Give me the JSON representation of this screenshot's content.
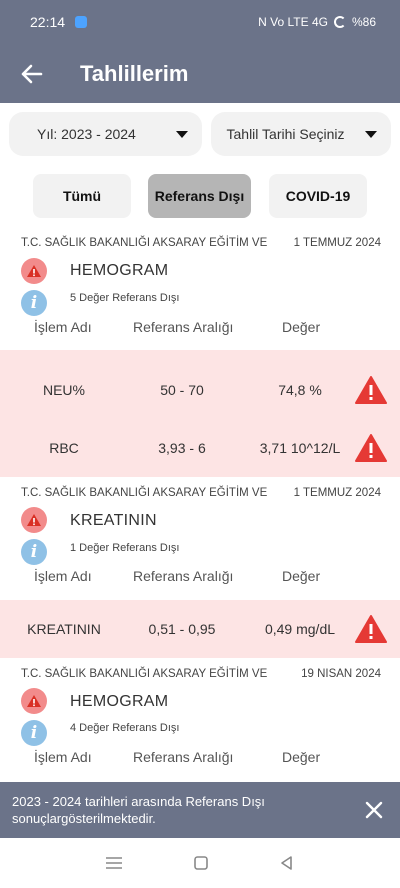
{
  "status_bar": {
    "time": "22:14",
    "indicators": "N  Vo LTE  4G",
    "battery": "%86"
  },
  "app_bar": {
    "title": "Tahlillerim"
  },
  "filters": {
    "year_label": "Yıl: 2023 - 2024",
    "date_label": "Tahlil Tarihi Seçiniz"
  },
  "tabs": [
    {
      "label": "Tümü",
      "active": false
    },
    {
      "label": "Referans Dışı",
      "active": true
    },
    {
      "label": "COVID-19",
      "active": false
    }
  ],
  "columns": {
    "name": "İşlem Adı",
    "range": "Referans Aralığı",
    "value": "Değer"
  },
  "reports": [
    {
      "institution": "T.C. SAĞLIK BAKANLIĞI AKSARAY EĞİTİM VE",
      "date": "1 TEMMUZ 2024",
      "test": "HEMOGRAM",
      "out_of_range": "5 Değer Referans Dışı",
      "results": [
        {
          "name": "NEU%",
          "range": "50 - 70",
          "value": "74,8 %"
        },
        {
          "name": "RBC",
          "range": "3,93 - 6",
          "value": "3,71 10^12/L"
        }
      ]
    },
    {
      "institution": "T.C. SAĞLIK BAKANLIĞI AKSARAY EĞİTİM VE",
      "date": "1 TEMMUZ 2024",
      "test": "KREATININ",
      "out_of_range": "1 Değer Referans Dışı",
      "results": [
        {
          "name": "KREATININ",
          "range": "0,51 - 0,95",
          "value": "0,49 mg/dL"
        }
      ]
    },
    {
      "institution": "T.C. SAĞLIK BAKANLIĞI AKSARAY EĞİTİM VE",
      "date": "19 NISAN 2024",
      "test": "HEMOGRAM",
      "out_of_range": "4 Değer Referans Dışı",
      "results": []
    }
  ],
  "snackbar": {
    "message": "2023 - 2024 tarihleri arasında Referans Dışı sonuçlargösterilmektedir."
  },
  "colors": {
    "bar": "#6b7389",
    "alert": "#e53935",
    "alert_soft": "#f28b8b",
    "info_soft": "#8fc1e6",
    "row_bg": "#fde4e4"
  }
}
